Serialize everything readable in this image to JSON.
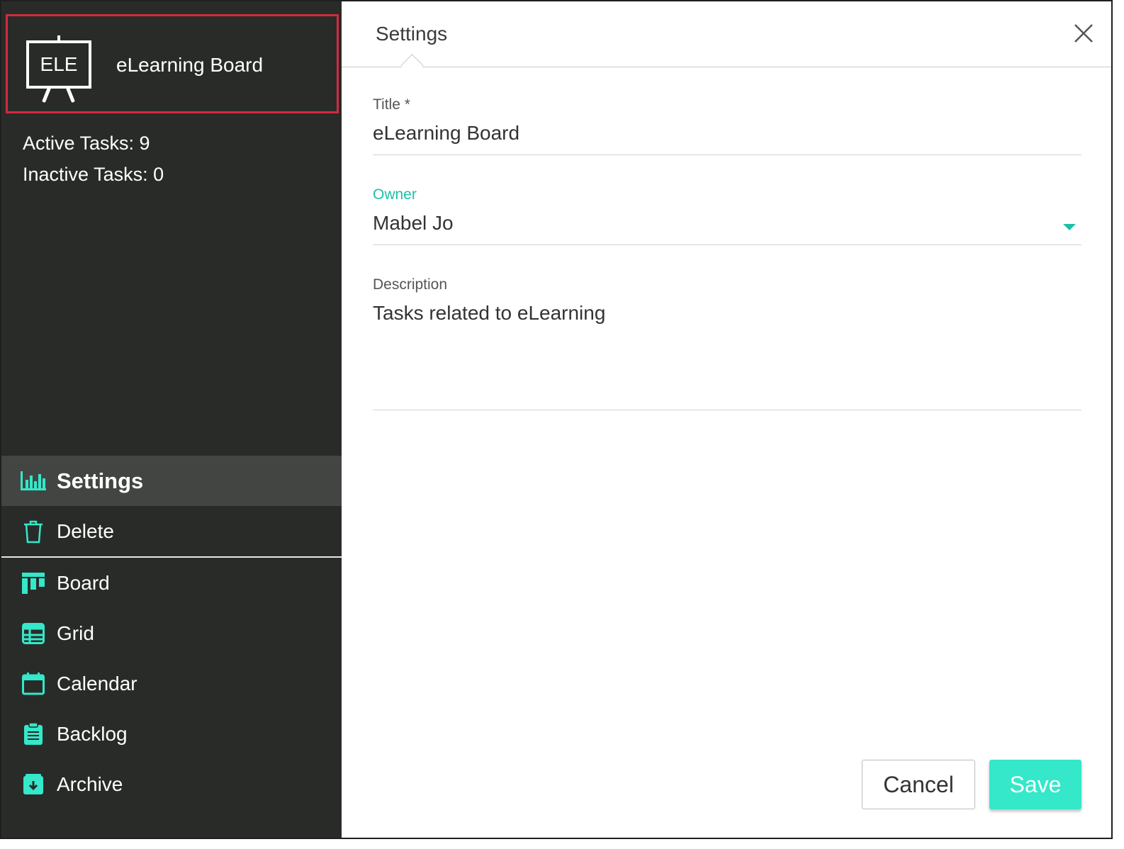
{
  "sidebar": {
    "board": {
      "icon_text": "ELE",
      "name": "eLearning Board"
    },
    "stats": {
      "active": "Active Tasks: 9",
      "inactive": "Inactive Tasks: 0"
    },
    "actions": [
      {
        "label": "Settings",
        "icon": "bar-chart-icon"
      },
      {
        "label": "Delete",
        "icon": "trash-icon"
      }
    ],
    "nav": [
      {
        "label": "Board",
        "icon": "board-columns-icon"
      },
      {
        "label": "Grid",
        "icon": "grid-table-icon"
      },
      {
        "label": "Calendar",
        "icon": "calendar-icon"
      },
      {
        "label": "Backlog",
        "icon": "clipboard-icon"
      },
      {
        "label": "Archive",
        "icon": "archive-box-icon"
      }
    ]
  },
  "dialog": {
    "tab": "Settings",
    "title_field": {
      "label": "Title *",
      "value": "eLearning Board"
    },
    "owner_field": {
      "label": "Owner",
      "value": "Mabel Jo"
    },
    "description_field": {
      "label": "Description",
      "value": "Tasks related to eLearning"
    },
    "cancel_label": "Cancel",
    "save_label": "Save"
  },
  "colors": {
    "sidebar_bg": "#292b29",
    "active_bg": "#434543",
    "accent": "#1fbfa6",
    "save_bg": "#34e8c9",
    "highlight_border": "#d32a3f"
  }
}
